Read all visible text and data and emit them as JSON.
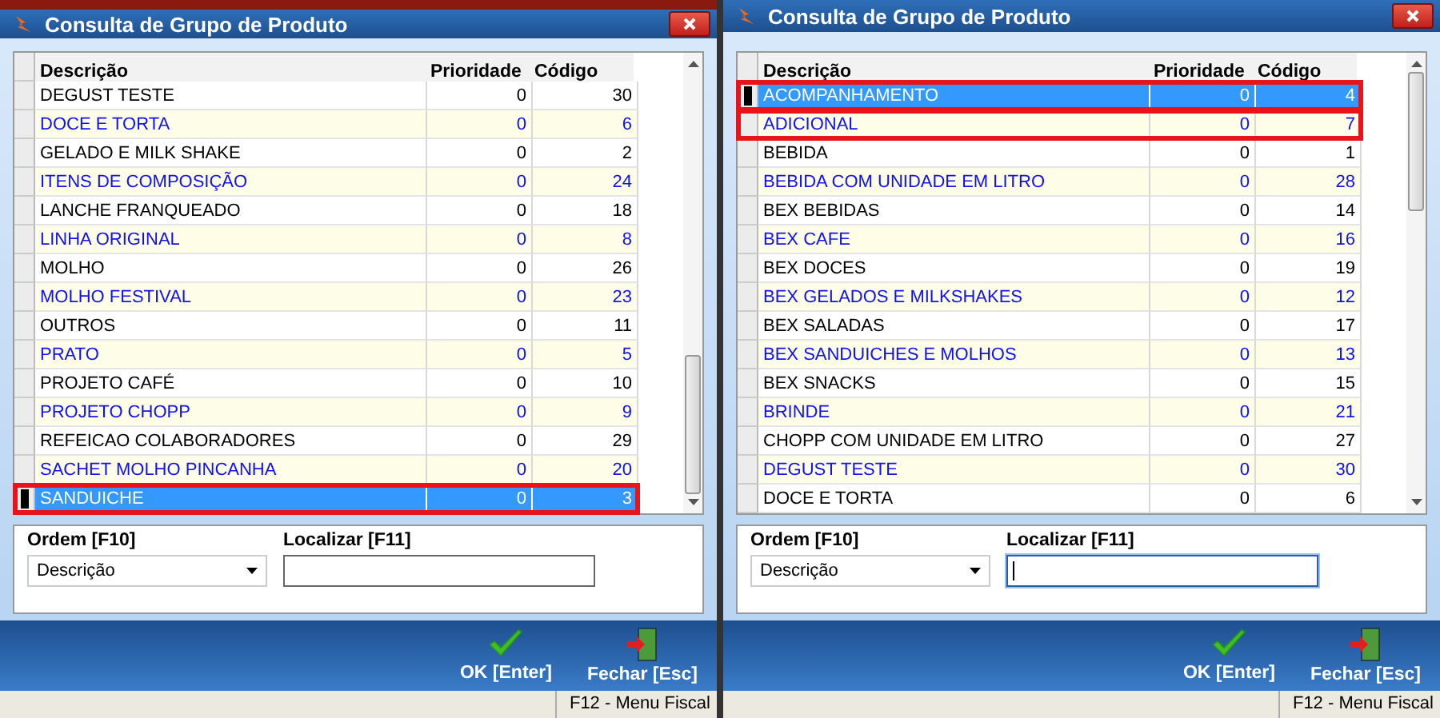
{
  "windows": [
    {
      "title": "Consulta de Grupo de Produto",
      "grid": {
        "columns": [
          "Descrição",
          "Prioridade",
          "Código"
        ],
        "rows": [
          {
            "description": "DEGUST TESTE",
            "priority": "0",
            "code": "30",
            "selected": false,
            "highlighted": false
          },
          {
            "description": "DOCE E TORTA",
            "priority": "0",
            "code": "6",
            "selected": false,
            "highlighted": false
          },
          {
            "description": "GELADO E MILK SHAKE",
            "priority": "0",
            "code": "2",
            "selected": false,
            "highlighted": false
          },
          {
            "description": "ITENS DE COMPOSIÇÃO",
            "priority": "0",
            "code": "24",
            "selected": false,
            "highlighted": false
          },
          {
            "description": "LANCHE FRANQUEADO",
            "priority": "0",
            "code": "18",
            "selected": false,
            "highlighted": false
          },
          {
            "description": "LINHA ORIGINAL",
            "priority": "0",
            "code": "8",
            "selected": false,
            "highlighted": false
          },
          {
            "description": "MOLHO",
            "priority": "0",
            "code": "26",
            "selected": false,
            "highlighted": false
          },
          {
            "description": "MOLHO FESTIVAL",
            "priority": "0",
            "code": "23",
            "selected": false,
            "highlighted": false
          },
          {
            "description": "OUTROS",
            "priority": "0",
            "code": "11",
            "selected": false,
            "highlighted": false
          },
          {
            "description": "PRATO",
            "priority": "0",
            "code": "5",
            "selected": false,
            "highlighted": false
          },
          {
            "description": "PROJETO CAFÉ",
            "priority": "0",
            "code": "10",
            "selected": false,
            "highlighted": false
          },
          {
            "description": "PROJETO CHOPP",
            "priority": "0",
            "code": "9",
            "selected": false,
            "highlighted": false
          },
          {
            "description": "REFEICAO COLABORADORES",
            "priority": "0",
            "code": "29",
            "selected": false,
            "highlighted": false
          },
          {
            "description": "SACHET MOLHO PINCANHA",
            "priority": "0",
            "code": "20",
            "selected": false,
            "highlighted": false
          },
          {
            "description": "SANDUICHE",
            "priority": "0",
            "code": "3",
            "selected": true,
            "highlighted": true
          }
        ]
      },
      "order": {
        "label": "Ordem [F10]",
        "value": "Descrição"
      },
      "search": {
        "label": "Localizar [F11]",
        "focused": false
      },
      "buttons": [
        {
          "kind": "ok",
          "label": "OK [Enter]"
        },
        {
          "kind": "close",
          "label": "Fechar [Esc]"
        }
      ],
      "status_bar": "F12 - Menu Fiscal"
    },
    {
      "title": "Consulta de Grupo de Produto",
      "grid": {
        "columns": [
          "Descrição",
          "Prioridade",
          "Código"
        ],
        "rows": [
          {
            "description": "ACOMPANHAMENTO",
            "priority": "0",
            "code": "4",
            "selected": true,
            "highlighted": true
          },
          {
            "description": "ADICIONAL",
            "priority": "0",
            "code": "7",
            "selected": false,
            "highlighted": true
          },
          {
            "description": "BEBIDA",
            "priority": "0",
            "code": "1",
            "selected": false,
            "highlighted": false
          },
          {
            "description": "BEBIDA COM UNIDADE EM LITRO",
            "priority": "0",
            "code": "28",
            "selected": false,
            "highlighted": false
          },
          {
            "description": "BEX BEBIDAS",
            "priority": "0",
            "code": "14",
            "selected": false,
            "highlighted": false
          },
          {
            "description": "BEX CAFE",
            "priority": "0",
            "code": "16",
            "selected": false,
            "highlighted": false
          },
          {
            "description": "BEX DOCES",
            "priority": "0",
            "code": "19",
            "selected": false,
            "highlighted": false
          },
          {
            "description": "BEX GELADOS E MILKSHAKES",
            "priority": "0",
            "code": "12",
            "selected": false,
            "highlighted": false
          },
          {
            "description": "BEX SALADAS",
            "priority": "0",
            "code": "17",
            "selected": false,
            "highlighted": false
          },
          {
            "description": "BEX SANDUICHES E MOLHOS",
            "priority": "0",
            "code": "13",
            "selected": false,
            "highlighted": false
          },
          {
            "description": "BEX SNACKS",
            "priority": "0",
            "code": "15",
            "selected": false,
            "highlighted": false
          },
          {
            "description": "BRINDE",
            "priority": "0",
            "code": "21",
            "selected": false,
            "highlighted": false
          },
          {
            "description": "CHOPP COM UNIDADE EM LITRO",
            "priority": "0",
            "code": "27",
            "selected": false,
            "highlighted": false
          },
          {
            "description": "DEGUST TESTE",
            "priority": "0",
            "code": "30",
            "selected": false,
            "highlighted": false
          },
          {
            "description": "DOCE E TORTA",
            "priority": "0",
            "code": "6",
            "selected": false,
            "highlighted": false
          }
        ]
      },
      "order": {
        "label": "Ordem [F10]",
        "value": "Descrição"
      },
      "search": {
        "label": "Localizar [F11]",
        "focused": true
      },
      "buttons": [
        {
          "kind": "ok",
          "label": "OK [Enter]"
        },
        {
          "kind": "close",
          "label": "Fechar [Esc]"
        }
      ],
      "status_bar": "F12 - Menu Fiscal"
    }
  ]
}
